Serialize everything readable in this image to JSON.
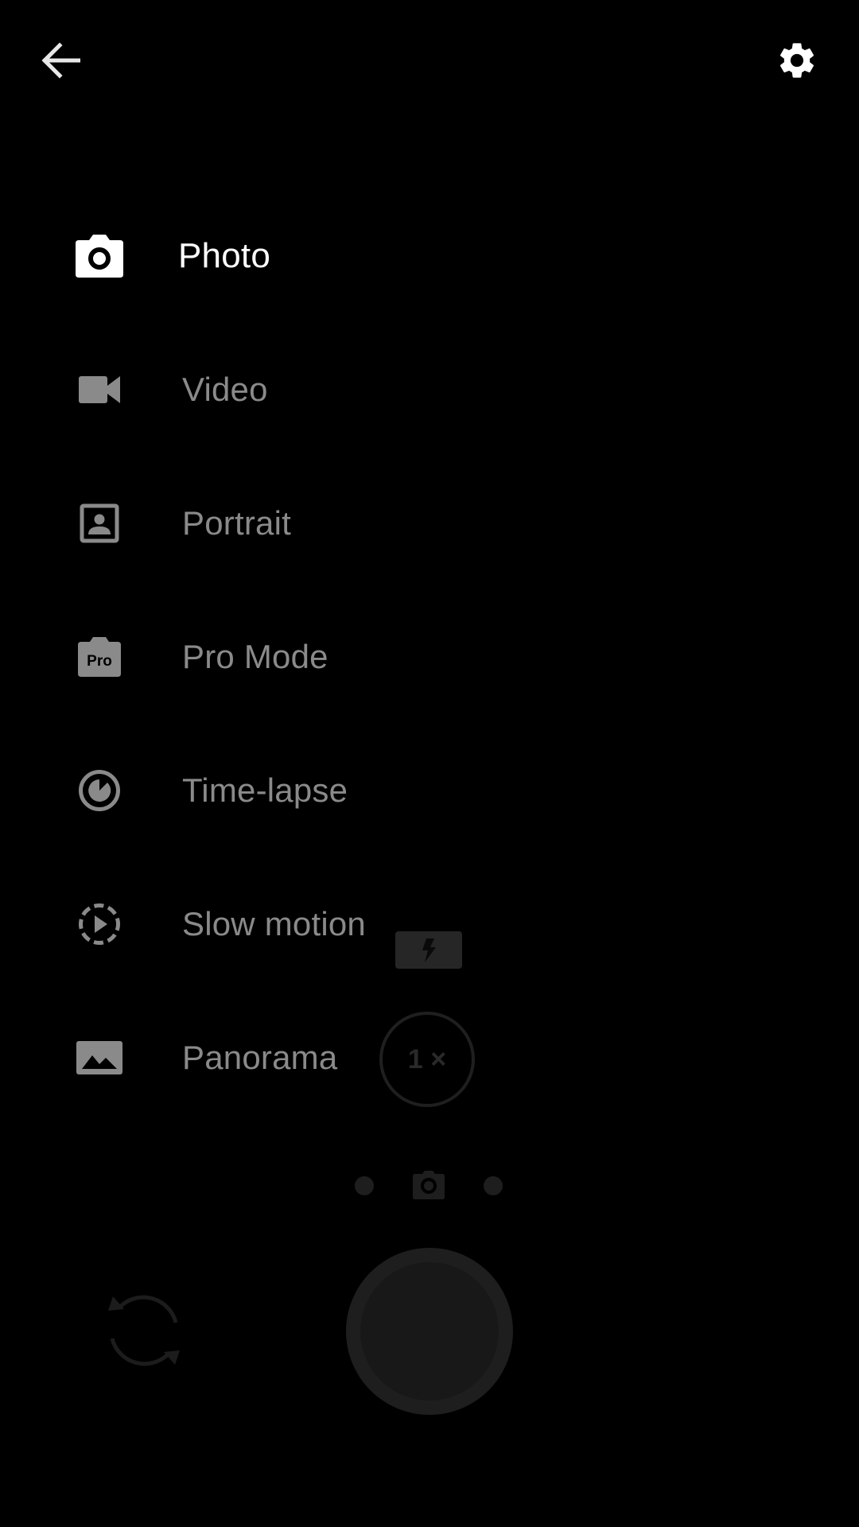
{
  "colors": {
    "background": "#000000",
    "selected_text": "#ffffff",
    "unselected_text": "#8a8a8a",
    "dimmed_ui": "#1e1e1e"
  },
  "top_bar": {
    "back_icon": "arrow-back-icon",
    "settings_icon": "gear-icon"
  },
  "mode_menu": {
    "items": [
      {
        "label": "Photo",
        "icon": "camera-icon",
        "selected": true
      },
      {
        "label": "Video",
        "icon": "videocam-icon",
        "selected": false
      },
      {
        "label": "Portrait",
        "icon": "portrait-icon",
        "selected": false
      },
      {
        "label": "Pro Mode",
        "icon": "pro-camera-icon",
        "icon_text": "Pro",
        "selected": false
      },
      {
        "label": "Time-lapse",
        "icon": "timelapse-icon",
        "selected": false
      },
      {
        "label": "Slow motion",
        "icon": "slow-motion-icon",
        "selected": false
      },
      {
        "label": "Panorama",
        "icon": "panorama-icon",
        "selected": false
      }
    ]
  },
  "camera_controls": {
    "zoom_label": "1 ×",
    "flash_icon": "flash-icon",
    "switch_camera_icon": "switch-camera-icon",
    "shutter_icon": "shutter-button"
  }
}
